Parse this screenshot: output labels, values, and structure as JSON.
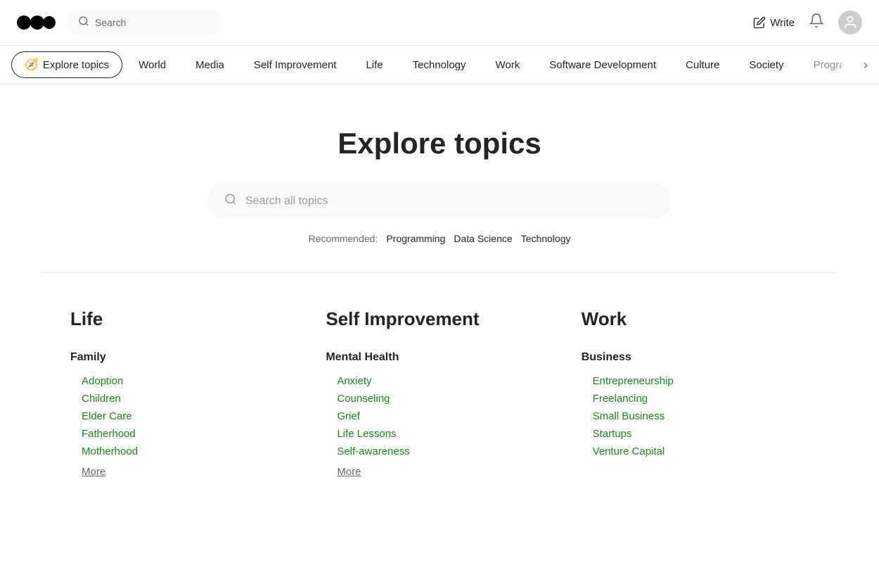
{
  "header": {
    "search_placeholder": "Search",
    "write_label": "Write"
  },
  "topics_nav": {
    "active_item": "Explore topics",
    "items": [
      "World",
      "Media",
      "Self Improvement",
      "Life",
      "Technology",
      "Work",
      "Software Development",
      "Culture",
      "Society",
      "Programming"
    ]
  },
  "hero": {
    "title": "Explore topics",
    "search_placeholder": "Search all topics",
    "recommended_label": "Recommended:",
    "recommended_items": [
      "Programming",
      "Data Science",
      "Technology"
    ]
  },
  "categories": [
    {
      "name": "Life",
      "subcategories": [
        {
          "name": "Family",
          "items": [
            "Adoption",
            "Children",
            "Elder Care",
            "Fatherhood",
            "Motherhood"
          ],
          "more_label": "More"
        }
      ]
    },
    {
      "name": "Self Improvement",
      "subcategories": [
        {
          "name": "Mental Health",
          "items": [
            "Anxiety",
            "Counseling",
            "Grief",
            "Life Lessons",
            "Self-awareness"
          ],
          "more_label": "More"
        }
      ]
    },
    {
      "name": "Work",
      "subcategories": [
        {
          "name": "Business",
          "items": [
            "Entrepreneurship",
            "Freelancing",
            "Small Business",
            "Startups",
            "Venture Capital"
          ],
          "more_label": null
        }
      ]
    }
  ]
}
